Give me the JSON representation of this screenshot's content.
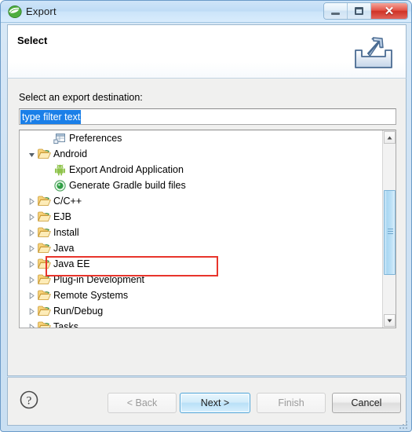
{
  "window": {
    "title": "Export",
    "app_icon": "eclipse-logo-icon",
    "controls": {
      "minimize": "minimize-icon",
      "maximize": "maximize-icon",
      "close": "✕"
    }
  },
  "header": {
    "title": "Select",
    "icon": "export-outbox-arrow-icon"
  },
  "body": {
    "destination_label": "Select an export destination:",
    "filter": {
      "value": "type filter text",
      "placeholder": "type filter text",
      "selected": true
    },
    "tree": [
      {
        "label": "Preferences",
        "depth": 1,
        "icon": "preferences-window-icon",
        "state": "leaf"
      },
      {
        "label": "Android",
        "depth": 0,
        "icon": "folder-open-icon",
        "state": "expanded"
      },
      {
        "label": "Export Android Application",
        "depth": 1,
        "icon": "android-robot-icon",
        "state": "leaf"
      },
      {
        "label": "Generate Gradle build files",
        "depth": 1,
        "icon": "gradle-icon",
        "state": "leaf",
        "highlighted": true
      },
      {
        "label": "C/C++",
        "depth": 0,
        "icon": "folder-open-icon",
        "state": "collapsed"
      },
      {
        "label": "EJB",
        "depth": 0,
        "icon": "folder-open-icon",
        "state": "collapsed"
      },
      {
        "label": "Install",
        "depth": 0,
        "icon": "folder-open-icon",
        "state": "collapsed"
      },
      {
        "label": "Java",
        "depth": 0,
        "icon": "folder-open-icon",
        "state": "collapsed"
      },
      {
        "label": "Java EE",
        "depth": 0,
        "icon": "folder-open-icon",
        "state": "collapsed"
      },
      {
        "label": "Plug-in Development",
        "depth": 0,
        "icon": "folder-open-icon",
        "state": "collapsed"
      },
      {
        "label": "Remote Systems",
        "depth": 0,
        "icon": "folder-open-icon",
        "state": "collapsed"
      },
      {
        "label": "Run/Debug",
        "depth": 0,
        "icon": "folder-open-icon",
        "state": "collapsed"
      },
      {
        "label": "Tasks",
        "depth": 0,
        "icon": "folder-open-icon",
        "state": "collapsed"
      }
    ],
    "scrollbar": {
      "up_arrow": "▲",
      "down_arrow": "▼"
    },
    "annotation_color": "#e8352c"
  },
  "footer": {
    "help": "?",
    "buttons": [
      {
        "label": "< Back",
        "enabled": false
      },
      {
        "label": "Next >",
        "enabled": true,
        "default": true
      },
      {
        "label": "Finish",
        "enabled": false
      },
      {
        "label": "Cancel",
        "enabled": true
      }
    ]
  },
  "colors": {
    "selection_blue": "#1a7fe8",
    "annotation_red": "#e8352c",
    "title_gradient_top": "#cfe5f8",
    "panel_gray": "#f0f0ef"
  }
}
